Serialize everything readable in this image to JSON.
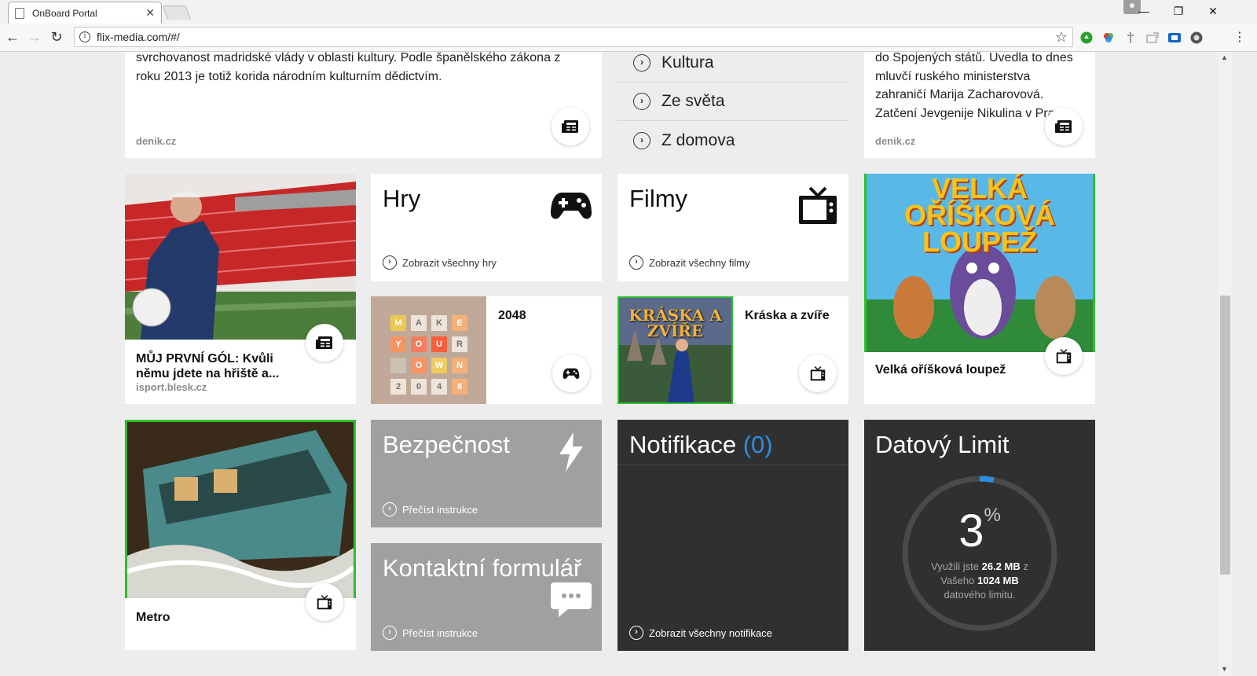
{
  "browser": {
    "tab_title": "OnBoard Portal",
    "url": "flix-media.com/#/"
  },
  "top_row": {
    "left_article": {
      "text": "svrchovanost madridské vlády v oblasti kultury. Podle španělského zákona z roku 2013 je totiž korida národním kulturním dědictvím.",
      "source": "denik.cz"
    },
    "categories": [
      "Kultura",
      "Ze světa",
      "Z domova"
    ],
    "right_article": {
      "text": "do Spojených států. Uvedla to dnes mluvčí ruského ministerstva zahraničí Marija Zacharovová. Zatčení Jevgenije Nikulina v Pra",
      "source": "denik.cz"
    }
  },
  "news_tile": {
    "headline": "MŮJ PRVNÍ GÓL: Kvůli němu jdete na hřiště a...",
    "source": "isport.blesk.cz"
  },
  "games_tile": {
    "title": "Hry",
    "link": "Zobrazit všechny hry"
  },
  "movies_tile": {
    "title": "Filmy",
    "link": "Zobrazit všechny filmy"
  },
  "game_2048": {
    "title": "2048",
    "grid": [
      "M",
      "A",
      "K",
      "E",
      "Y",
      "O",
      "U",
      "R",
      "",
      "O",
      "W",
      "N",
      "2",
      "0",
      "4",
      "8"
    ]
  },
  "movie_kraska": {
    "title": "Kráska a zvíře",
    "poster_text": "KRÁSKA A ZVÍŘE"
  },
  "movie_loupez": {
    "title": "Velká oříšková loupež",
    "poster_text": "VELKÁ OŘÍŠKOVÁ LOUPEŽ"
  },
  "metro_tile": {
    "title": "Metro"
  },
  "security_tile": {
    "title": "Bezpečnost",
    "link": "Přečíst instrukce"
  },
  "contact_tile": {
    "title": "Kontaktní formulář",
    "link": "Přečíst instrukce"
  },
  "notifications_tile": {
    "title": "Notifikace",
    "count": "(0)",
    "link": "Zobrazit všechny notifikace"
  },
  "data_limit_tile": {
    "title": "Datový Limit",
    "percent": "3",
    "percent_sign": "%",
    "used_prefix": "Využili jste",
    "used_value": "26.2 MB",
    "used_mid": "z",
    "total_prefix": "Vašeho",
    "total_value": "1024 MB",
    "total_suffix": "datového limitu.",
    "fraction": 0.03
  },
  "colors": {
    "accent_blue": "#2f8ee0",
    "highlight_green": "#2ec02e",
    "dark_tile": "#303030",
    "grey_tile": "#a0a0a0"
  }
}
